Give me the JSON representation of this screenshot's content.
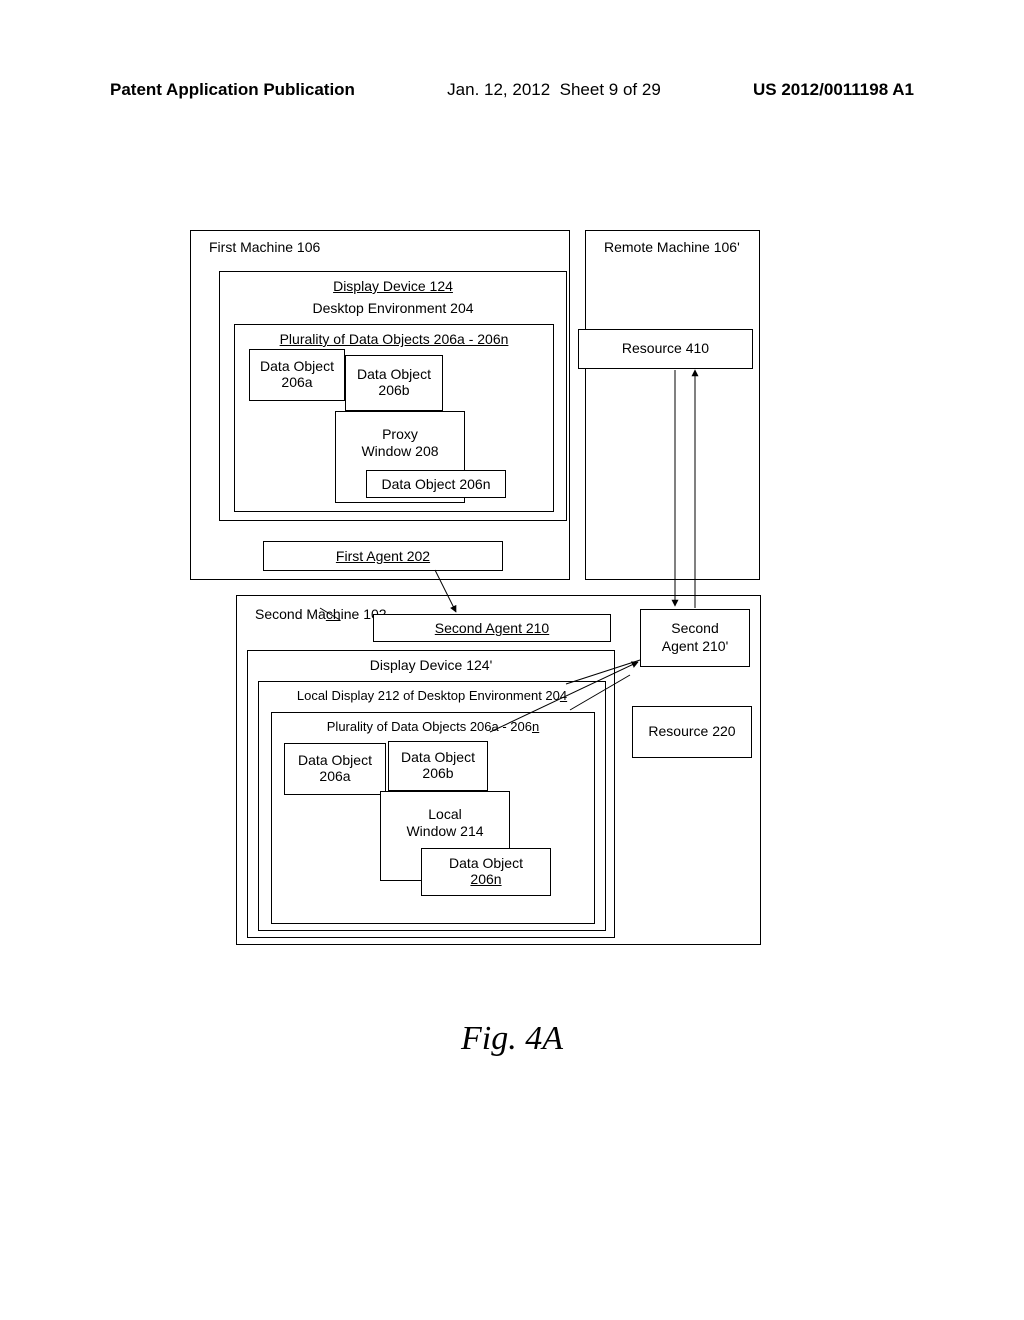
{
  "header": {
    "pub": "Patent Application Publication",
    "date": "Jan. 12, 2012",
    "sheet": "Sheet 9 of 29",
    "pubno": "US 2012/0011198 A1"
  },
  "figure_label": "Fig. 4A",
  "boxes": {
    "first_machine": "First Machine 106",
    "remote_machine": "Remote Machine 106'",
    "display_device_1": "Display Device 124",
    "desktop_env_1": "Desktop Environment 204",
    "plurality_1": "Plurality of Data Objects 206a - 206n",
    "data_obj_a1": "Data Object 206a",
    "data_obj_b1": "Data Object 206b",
    "proxy_window": "Proxy Window 208",
    "data_obj_n1": "Data Object 206n",
    "first_agent": "First Agent 202",
    "resource_410": "Resource 410",
    "second_machine": "Second Machine 102",
    "second_agent": "Second Agent 210",
    "second_agent_p": "Second Agent 210'",
    "display_device_2": "Display Device 124'",
    "local_display": "Local Display 212 of Desktop Environment 204",
    "plurality_2": "Plurality of Data Objects 206a - 206n",
    "data_obj_a2": "Data Object 206a",
    "data_obj_b2": "Data Object 206b",
    "local_window": "Local Window 214",
    "data_obj_n2": "Data Object 206n",
    "resource_220": "Resource 220"
  }
}
